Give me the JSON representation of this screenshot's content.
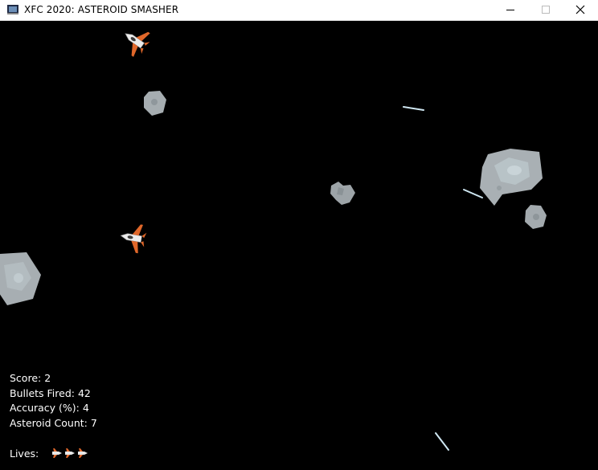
{
  "window": {
    "title": "XFC 2020: ASTEROID SMASHER",
    "icons": [
      "app-icon",
      "minimize-icon",
      "maximize-icon",
      "close-icon"
    ]
  },
  "hud": {
    "score_label": "Score:",
    "score_value": "2",
    "bullets_label": "Bullets Fired:",
    "bullets_value": "42",
    "accuracy_label": "Accuracy (%):",
    "accuracy_value": "4",
    "asteroid_label": "Asteroid Count:",
    "asteroid_value": "7",
    "lives_label": "Lives:",
    "lives_count": 3
  },
  "colors": {
    "background": "#000000",
    "asteroid": "#a9b0b4",
    "ship_body": "#e8e8e8",
    "ship_accent": "#e0672a",
    "bullet": "#cfe7f2"
  }
}
